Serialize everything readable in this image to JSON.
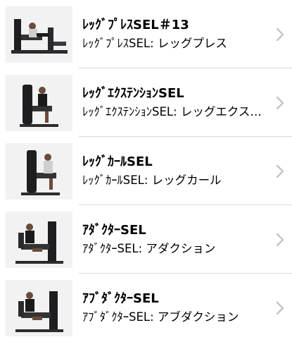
{
  "items": [
    {
      "title": "ﾚｯｸﾞﾌﾟﾚｽSEL＃13",
      "subtitle": "ﾚｯｸﾞﾌﾟﾚｽSEL: レッグプレス",
      "icon": "leg-press-machine-image"
    },
    {
      "title": "ﾚｯｸﾞｴｸｽﾃﾝｼｮﾝSEL",
      "subtitle": "ﾚｯｸﾞｴｸｽﾃﾝｼｮﾝSEL: レッグエクステンション",
      "icon": "leg-extension-machine-image"
    },
    {
      "title": "ﾚｯｸﾞｶｰﾙSEL",
      "subtitle": "ﾚｯｸﾞｶｰﾙSEL: レッグカール",
      "icon": "leg-curl-machine-image"
    },
    {
      "title": "ｱﾀﾞｸﾀｰSEL",
      "subtitle": "ｱﾀﾞｸﾀｰSEL: アダクション",
      "icon": "adductor-machine-image"
    },
    {
      "title": "ｱﾌﾞﾀﾞｸﾀｰSEL",
      "subtitle": "ｱﾌﾞﾀﾞｸﾀｰSEL: アブダクション",
      "icon": "abductor-machine-image"
    }
  ],
  "chevron_icon": "chevron-right-icon",
  "colors": {
    "separator": "#d9d9dc",
    "chevron": "#c4c4c7",
    "thumb_bg": "#f2f2f3"
  }
}
